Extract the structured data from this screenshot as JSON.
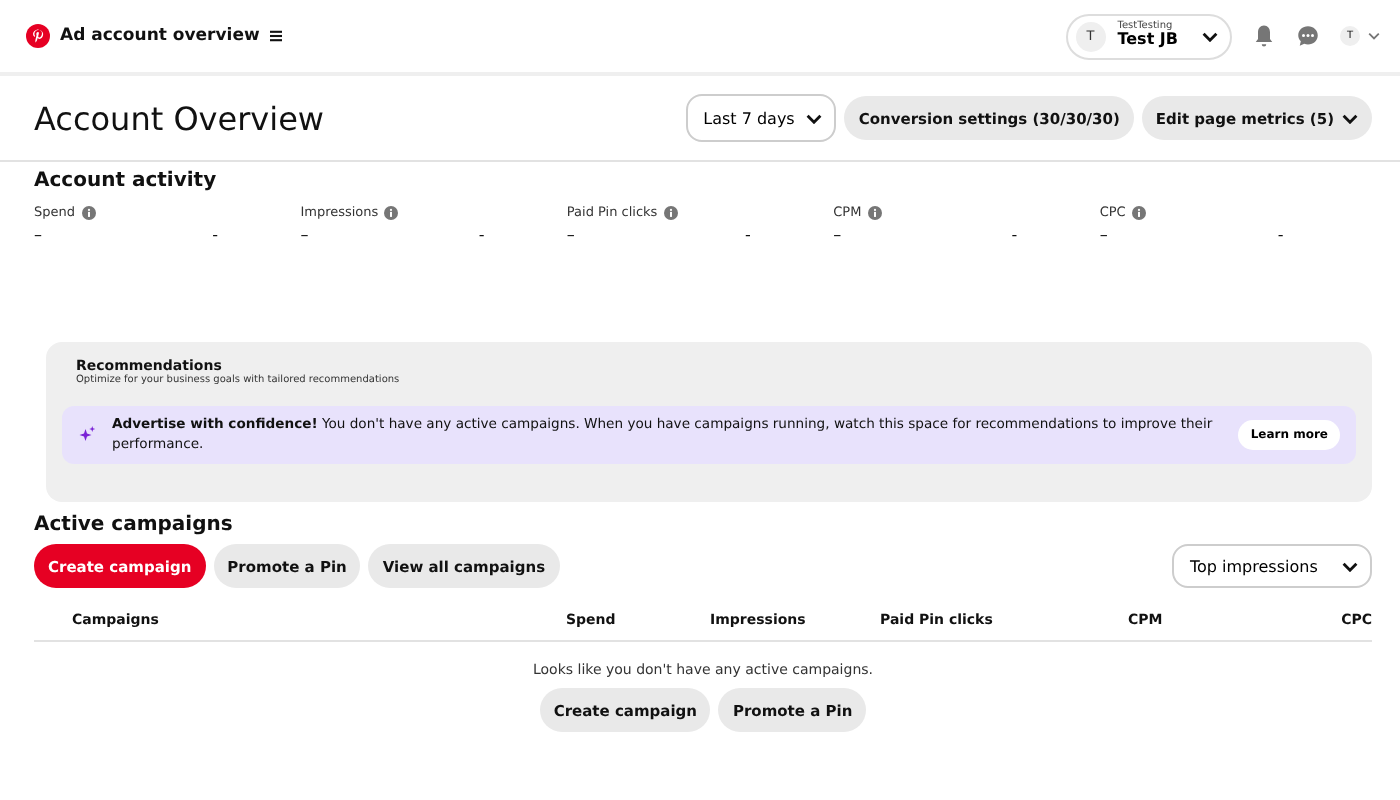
{
  "header": {
    "title": "Ad account overview",
    "account": {
      "avatar": "T",
      "business": "TestTesting",
      "name": "Test JB"
    },
    "user_avatar": "T"
  },
  "page": {
    "title": "Account Overview",
    "date_range": "Last 7 days",
    "conversion_button": "Conversion settings (30/30/30)",
    "metrics_button": "Edit page metrics (5)"
  },
  "activity": {
    "title": "Account activity",
    "metrics": [
      {
        "label": "Spend",
        "value": "–",
        "change": "-"
      },
      {
        "label": "Impressions",
        "value": "–",
        "change": "-"
      },
      {
        "label": "Paid Pin clicks",
        "value": "–",
        "change": "-"
      },
      {
        "label": "CPM",
        "value": "–",
        "change": "-"
      },
      {
        "label": "CPC",
        "value": "–",
        "change": "-"
      }
    ]
  },
  "recommendations": {
    "title": "Recommendations",
    "subtitle": "Optimize for your business goals with tailored recommendations",
    "message": "**Advertise with confidence!** You don't have any active campaigns. When you have campaigns running, watch this space for recommendations to improve their performance.",
    "button": "Learn more"
  },
  "campaigns": {
    "title": "Active campaigns",
    "buttons": [
      {
        "label": "Create campaign",
        "kind": "primary"
      },
      {
        "label": "Promote a Pin",
        "kind": "secondary"
      },
      {
        "label": "View all campaigns",
        "kind": "secondary"
      }
    ],
    "sort": "Top impressions",
    "columns": [
      "Campaigns",
      "Spend",
      "Impressions",
      "Paid Pin clicks",
      "CPM",
      "CPC"
    ],
    "empty_message": "Looks like you don't have any active campaigns.",
    "empty_buttons": [
      "Create campaign",
      "Promote a Pin"
    ]
  }
}
